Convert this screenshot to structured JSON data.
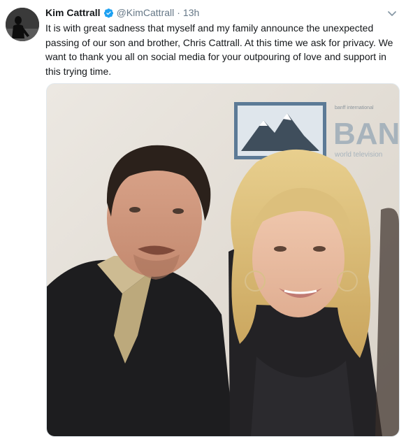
{
  "tweet": {
    "author": {
      "name": "Kim Cattrall",
      "handle": "@KimCattrall",
      "verified": true,
      "avatar": "avatar-photo"
    },
    "separator": "·",
    "timestamp": "13h",
    "menu_icon": "chevron-down-icon",
    "text": "It is with great sadness that myself and my family announce the unexpected passing of our son and brother, Chris Cattrall. At this time we ask for privacy. We want to thank you all on social media for your outpouring of love and support in this trying time.",
    "media": {
      "type": "photo",
      "backdrop_logo_text": "BAN",
      "backdrop_small_text_1": "banff international",
      "backdrop_small_text_2": "world television"
    }
  },
  "colors": {
    "text": "#14171a",
    "secondary": "#657786",
    "verified": "#1da1f2",
    "border": "#e1e8ed"
  }
}
